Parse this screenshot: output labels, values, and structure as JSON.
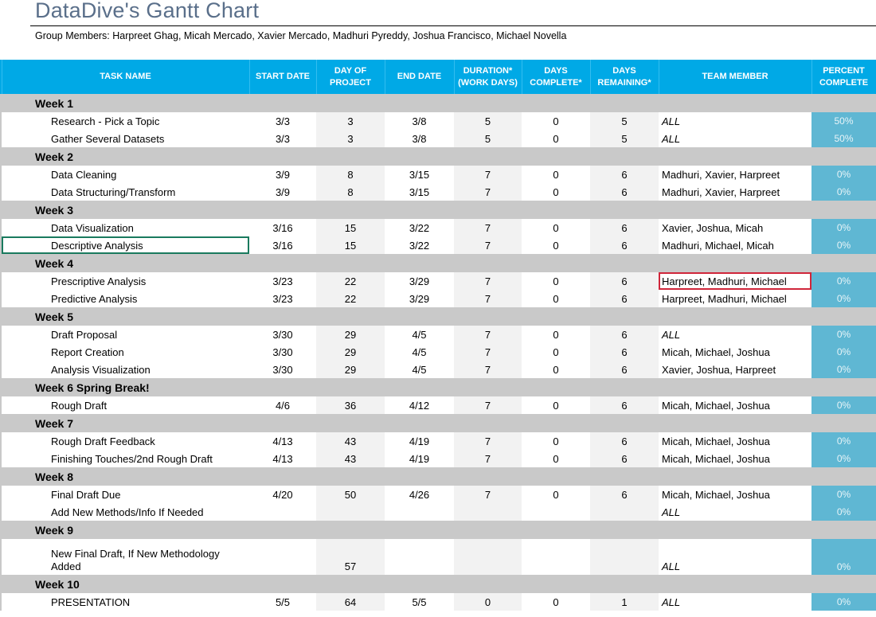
{
  "title": "DataDive's Gantt Chart",
  "members": "Group Members: Harpreet Ghag, Micah Mercado, Xavier Mercado, Madhuri Pyreddy, Joshua Francisco, Michael Novella",
  "headers": [
    "TASK NAME",
    "START DATE",
    "DAY OF PROJECT",
    "END DATE",
    "DURATION* (WORK DAYS)",
    "DAYS COMPLETE*",
    "DAYS REMAINING*",
    "TEAM MEMBER",
    "PERCENT COMPLETE"
  ],
  "colors": {
    "header_bg": "#00a9e6",
    "week_bg": "#c9c9c9",
    "pct_bg": "#5fb7d3"
  },
  "weeks": [
    {
      "label": "Week 1",
      "tasks": [
        {
          "name": "Research - Pick a Topic",
          "start": "3/3",
          "day": "3",
          "end": "3/8",
          "duration": "5",
          "complete": "0",
          "remaining": "5",
          "member": "ALL",
          "pct": "50%"
        },
        {
          "name": "Gather Several Datasets",
          "start": "3/3",
          "day": "3",
          "end": "3/8",
          "duration": "5",
          "complete": "0",
          "remaining": "5",
          "member": "ALL",
          "pct": "50%"
        }
      ]
    },
    {
      "label": "Week 2",
      "tasks": [
        {
          "name": "Data Cleaning",
          "start": "3/9",
          "day": "8",
          "end": "3/15",
          "duration": "7",
          "complete": "0",
          "remaining": "6",
          "member": "Madhuri, Xavier, Harpreet",
          "pct": "0%"
        },
        {
          "name": "Data Structuring/Transform",
          "start": "3/9",
          "day": "8",
          "end": "3/15",
          "duration": "7",
          "complete": "0",
          "remaining": "6",
          "member": "Madhuri, Xavier, Harpreet",
          "pct": "0%"
        }
      ]
    },
    {
      "label": "Week 3",
      "tasks": [
        {
          "name": "Data Visualization",
          "start": "3/16",
          "day": "15",
          "end": "3/22",
          "duration": "7",
          "complete": "0",
          "remaining": "6",
          "member": "Xavier, Joshua, Micah",
          "pct": "0%"
        },
        {
          "name": "Descriptive Analysis",
          "start": "3/16",
          "day": "15",
          "end": "3/22",
          "duration": "7",
          "complete": "0",
          "remaining": "6",
          "member": "Madhuri, Michael, Micah",
          "pct": "0%"
        }
      ]
    },
    {
      "label": "Week 4",
      "tasks": [
        {
          "name": "Prescriptive Analysis",
          "start": "3/23",
          "day": "22",
          "end": "3/29",
          "duration": "7",
          "complete": "0",
          "remaining": "6",
          "member": "Harpreet, Madhuri, Michael",
          "pct": "0%"
        },
        {
          "name": "Predictive Analysis",
          "start": "3/23",
          "day": "22",
          "end": "3/29",
          "duration": "7",
          "complete": "0",
          "remaining": "6",
          "member": "Harpreet, Madhuri, Michael",
          "pct": "0%"
        }
      ]
    },
    {
      "label": "Week 5",
      "tasks": [
        {
          "name": "Draft Proposal",
          "start": "3/30",
          "day": "29",
          "end": "4/5",
          "duration": "7",
          "complete": "0",
          "remaining": "6",
          "member": "ALL",
          "pct": "0%"
        },
        {
          "name": "Report Creation",
          "start": "3/30",
          "day": "29",
          "end": "4/5",
          "duration": "7",
          "complete": "0",
          "remaining": "6",
          "member": "Micah, Michael, Joshua",
          "pct": "0%"
        },
        {
          "name": "Analysis Visualization",
          "start": "3/30",
          "day": "29",
          "end": "4/5",
          "duration": "7",
          "complete": "0",
          "remaining": "6",
          "member": "Xavier, Joshua, Harpreet",
          "pct": "0%"
        }
      ]
    },
    {
      "label": "Week 6 Spring Break!",
      "tasks": [
        {
          "name": "Rough Draft",
          "start": "4/6",
          "day": "36",
          "end": "4/12",
          "duration": "7",
          "complete": "0",
          "remaining": "6",
          "member": "Micah, Michael, Joshua",
          "pct": "0%"
        }
      ]
    },
    {
      "label": "Week 7",
      "tasks": [
        {
          "name": "Rough Draft Feedback",
          "start": "4/13",
          "day": "43",
          "end": "4/19",
          "duration": "7",
          "complete": "0",
          "remaining": "6",
          "member": "Micah, Michael, Joshua",
          "pct": "0%"
        },
        {
          "name": "Finishing Touches/2nd Rough Draft",
          "start": "4/13",
          "day": "43",
          "end": "4/19",
          "duration": "7",
          "complete": "0",
          "remaining": "6",
          "member": "Micah, Michael, Joshua",
          "pct": "0%"
        }
      ]
    },
    {
      "label": "Week 8",
      "tasks": [
        {
          "name": "Final Draft Due",
          "start": "4/20",
          "day": "50",
          "end": "4/26",
          "duration": "7",
          "complete": "0",
          "remaining": "6",
          "member": "Micah, Michael, Joshua",
          "pct": "0%"
        },
        {
          "name": "Add New Methods/Info If Needed",
          "start": "",
          "day": "",
          "end": "",
          "duration": "",
          "complete": "",
          "remaining": "",
          "member": "ALL",
          "pct": "0%"
        }
      ]
    },
    {
      "label": "Week 9",
      "tasks": [
        {
          "name": "New Final Draft, If New Methodology Added",
          "start": "",
          "day": "57",
          "end": "",
          "duration": "",
          "complete": "",
          "remaining": "",
          "member": "ALL",
          "pct": "0%"
        }
      ]
    },
    {
      "label": "Week 10",
      "tasks": [
        {
          "name": "PRESENTATION",
          "start": "5/5",
          "day": "64",
          "end": "5/5",
          "duration": "0",
          "complete": "0",
          "remaining": "1",
          "member": "ALL",
          "pct": "0%"
        }
      ]
    }
  ]
}
